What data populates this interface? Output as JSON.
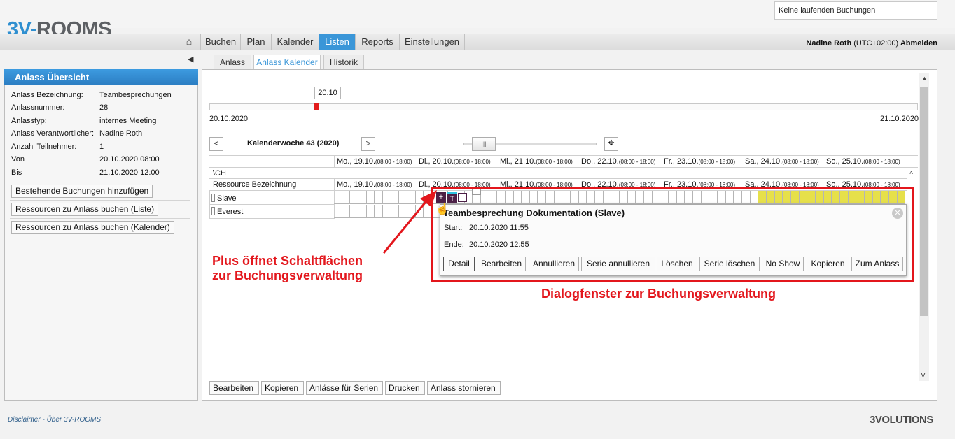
{
  "status_box": "Keine laufenden Buchungen",
  "logo": {
    "prefix": "3V-",
    "name": "ROOMS"
  },
  "nav": {
    "items": [
      "Buchen",
      "Plan",
      "Kalender",
      "Listen",
      "Reports",
      "Einstellungen"
    ],
    "active": "Listen"
  },
  "user": {
    "name": "Nadine Roth",
    "tz": "(UTC+02:00)",
    "logout": "Abmelden"
  },
  "tabs": {
    "items": [
      "Anlass",
      "Anlass Kalender",
      "Historik"
    ],
    "active": "Anlass Kalender"
  },
  "overview": {
    "title": "Anlass Übersicht",
    "fields": [
      {
        "label": "Anlass Bezeichnung:",
        "value": "Teambesprechungen"
      },
      {
        "label": "Anlassnummer:",
        "value": "28"
      },
      {
        "label": "Anlasstyp:",
        "value": "internes Meeting"
      },
      {
        "label": "Anlass Verantwortlicher:",
        "value": "Nadine Roth"
      },
      {
        "label": "Anzahl Teilnehmer:",
        "value": "1"
      },
      {
        "label": "Von",
        "value": "20.10.2020 08:00"
      },
      {
        "label": "Bis",
        "value": "21.10.2020 12:00"
      }
    ],
    "buttons": [
      "Bestehende Buchungen hinzufügen",
      "Ressourcen zu Anlass buchen (Liste)",
      "Ressourcen zu Anlass buchen (Kalender)"
    ]
  },
  "timeline": {
    "bubble": "20.10",
    "start": "20.10.2020",
    "end": "21.10.2020"
  },
  "week": {
    "label": "Kalenderwoche 43 (2020)",
    "prev": "<",
    "next": ">"
  },
  "days": [
    {
      "d": "Mo., 19.10.",
      "t": "(08:00 - 18:00)"
    },
    {
      "d": "Di., 20.10.",
      "t": "(08:00 - 18:00)"
    },
    {
      "d": "Mi., 21.10.",
      "t": "(08:00 - 18:00)"
    },
    {
      "d": "Do., 22.10.",
      "t": "(08:00 - 18:00)"
    },
    {
      "d": "Fr., 23.10.",
      "t": "(08:00 - 18:00)"
    },
    {
      "d": "Sa., 24.10.",
      "t": "(08:00 - 18:00)"
    },
    {
      "d": "So., 25.10.",
      "t": "(08:00 - 18:00)"
    }
  ],
  "grid": {
    "location": "\\CH",
    "col_header": "Ressource Bezeichnung",
    "resources": [
      "Slave",
      "Everest"
    ]
  },
  "booking": {
    "add": "+",
    "tag": "T"
  },
  "dialog": {
    "title": "Teambesprechung Dokumentation (Slave)",
    "start_label": "Start:",
    "start": "20.10.2020 11:55",
    "end_label": "Ende:",
    "end": "20.10.2020 12:55",
    "buttons": [
      "Detail",
      "Bearbeiten",
      "Annullieren",
      "Serie annullieren",
      "Löschen",
      "Serie löschen",
      "No Show",
      "Kopieren",
      "Zum Anlass"
    ]
  },
  "annotations": {
    "plus_line1": "Plus öffnet Schaltflächen",
    "plus_line2": "zur Buchungsverwaltung",
    "dialog": "Dialogfenster zur Buchungsverwaltung"
  },
  "bottom_buttons": [
    "Bearbeiten",
    "Kopieren",
    "Anlässe für Serien",
    "Drucken",
    "Anlass stornieren"
  ],
  "footer": {
    "disclaimer": "Disclaimer",
    "sep": "-",
    "about": "Über 3V-ROOMS",
    "brand": "3VOLUTIONS"
  },
  "colors": {
    "accent": "#3a96d8",
    "annotation": "#e3161c",
    "booking": "#4c1f46",
    "weekend": "#e6e04a"
  }
}
